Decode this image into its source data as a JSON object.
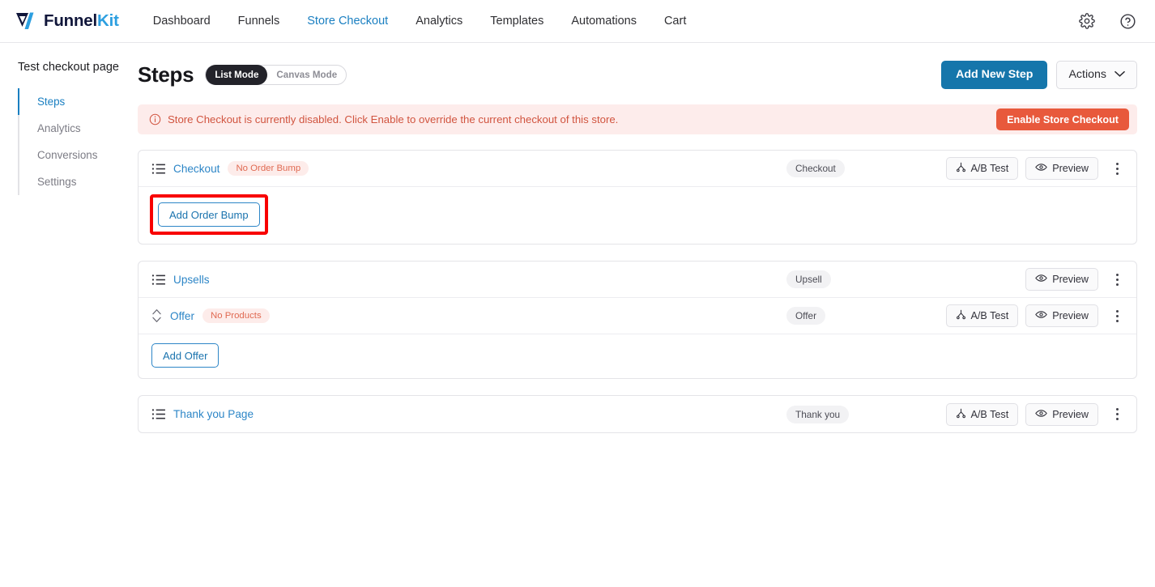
{
  "header": {
    "brand": {
      "name_dark": "Funnel",
      "name_accent": "Kit",
      "logo_icon": "funnelkit-logo-icon"
    },
    "nav": [
      {
        "label": "Dashboard",
        "active": false
      },
      {
        "label": "Funnels",
        "active": false
      },
      {
        "label": "Store Checkout",
        "active": true
      },
      {
        "label": "Analytics",
        "active": false
      },
      {
        "label": "Templates",
        "active": false
      },
      {
        "label": "Automations",
        "active": false
      },
      {
        "label": "Cart",
        "active": false
      }
    ],
    "settings_icon": "gear-icon",
    "help_icon": "help-circle-icon"
  },
  "sidebar": {
    "title": "Test checkout page",
    "items": [
      {
        "label": "Steps",
        "active": true
      },
      {
        "label": "Analytics",
        "active": false
      },
      {
        "label": "Conversions",
        "active": false
      },
      {
        "label": "Settings",
        "active": false
      }
    ]
  },
  "page": {
    "title": "Steps",
    "modes": [
      {
        "label": "List Mode",
        "active": true
      },
      {
        "label": "Canvas Mode",
        "active": false
      }
    ],
    "add_new_step": "Add New Step",
    "actions": "Actions"
  },
  "alert": {
    "icon": "info-circle-icon",
    "message": "Store Checkout is currently disabled. Click Enable to override the current checkout of this store.",
    "action_label": "Enable Store Checkout"
  },
  "common": {
    "ab_test_label": "A/B Test",
    "preview_label": "Preview",
    "ab_test_icon": "split-test-icon",
    "preview_icon": "eye-icon",
    "kebab_icon": "more-vertical-icon",
    "list_handle_icon": "list-icon",
    "sort_handle_icon": "sort-updown-icon"
  },
  "steps": [
    {
      "name": "Checkout",
      "badge": "No Order Bump",
      "type": "Checkout",
      "has_ab_test": true,
      "preview": "Preview",
      "footer_button": "Add Order Bump",
      "footer_highlighted": true
    },
    {
      "name": "Upsells",
      "badge": "",
      "type": "Upsell",
      "has_ab_test": false,
      "preview": "Preview",
      "child": {
        "name": "Offer",
        "badge": "No Products",
        "type": "Offer",
        "has_ab_test": true,
        "preview": "Preview"
      },
      "footer_button": "Add Offer",
      "footer_highlighted": false
    },
    {
      "name": "Thank you Page",
      "badge": "",
      "type": "Thank you",
      "has_ab_test": true,
      "preview": "Preview",
      "footer_button": "",
      "footer_highlighted": false
    }
  ],
  "colors": {
    "primary_blue": "#1576ab",
    "link_blue": "#2d86c7",
    "danger_orange": "#e8593c",
    "alert_bg": "#fdeceb",
    "highlight_red": "#f80000"
  }
}
